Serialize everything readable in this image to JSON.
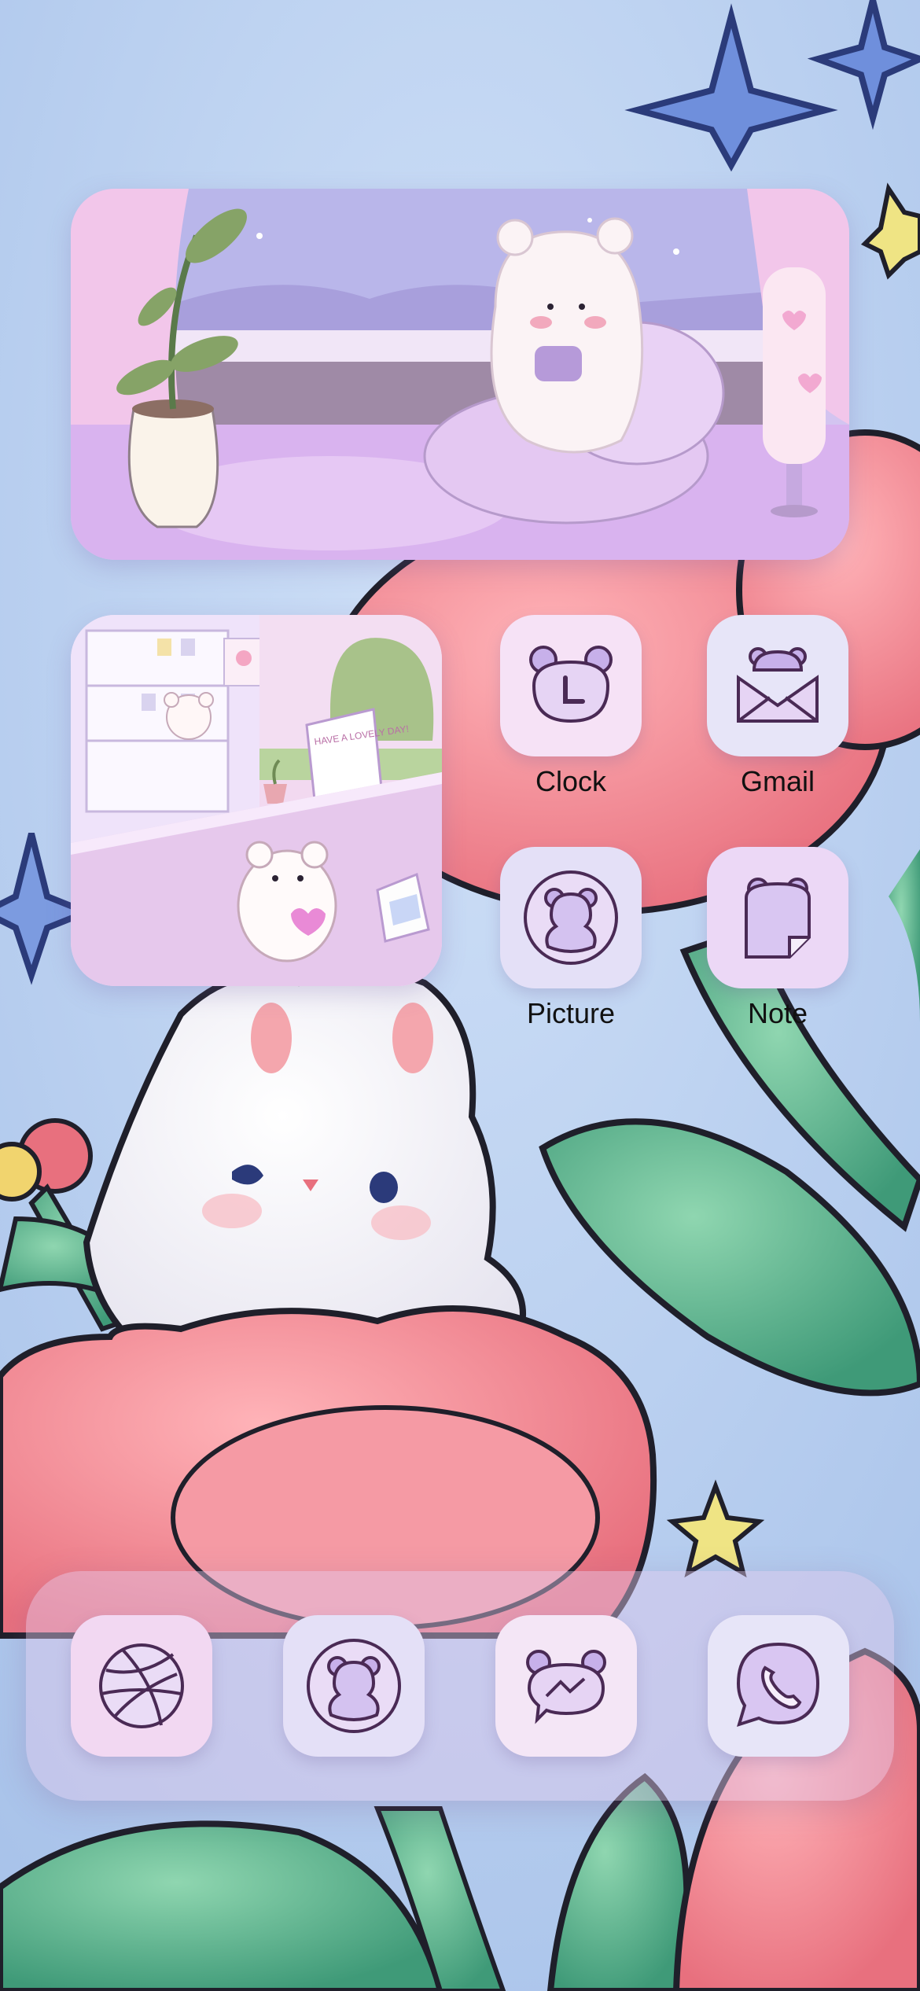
{
  "apps": {
    "clock": {
      "label": "Clock",
      "icon": "bear-clock-icon"
    },
    "gmail": {
      "label": "Gmail",
      "icon": "bear-envelope-icon"
    },
    "picture": {
      "label": "Picture",
      "icon": "bear-circle-icon"
    },
    "note": {
      "label": "Note",
      "icon": "bear-note-icon"
    }
  },
  "widget_large": {
    "icon": "bear-with-cup-image"
  },
  "widget_small": {
    "sign_text": "HAVE A LOVELY DAY!",
    "icon": "bear-shop-image"
  },
  "dock": [
    {
      "icon": "dribbble-ball-icon"
    },
    {
      "icon": "bear-circle-icon"
    },
    {
      "icon": "bear-messenger-icon"
    },
    {
      "icon": "whatsapp-phone-icon"
    }
  ],
  "colors": {
    "icon_bg": "#f3dcf5",
    "icon_stroke": "#4a2a55",
    "widget_pink": "#f4cde8"
  }
}
